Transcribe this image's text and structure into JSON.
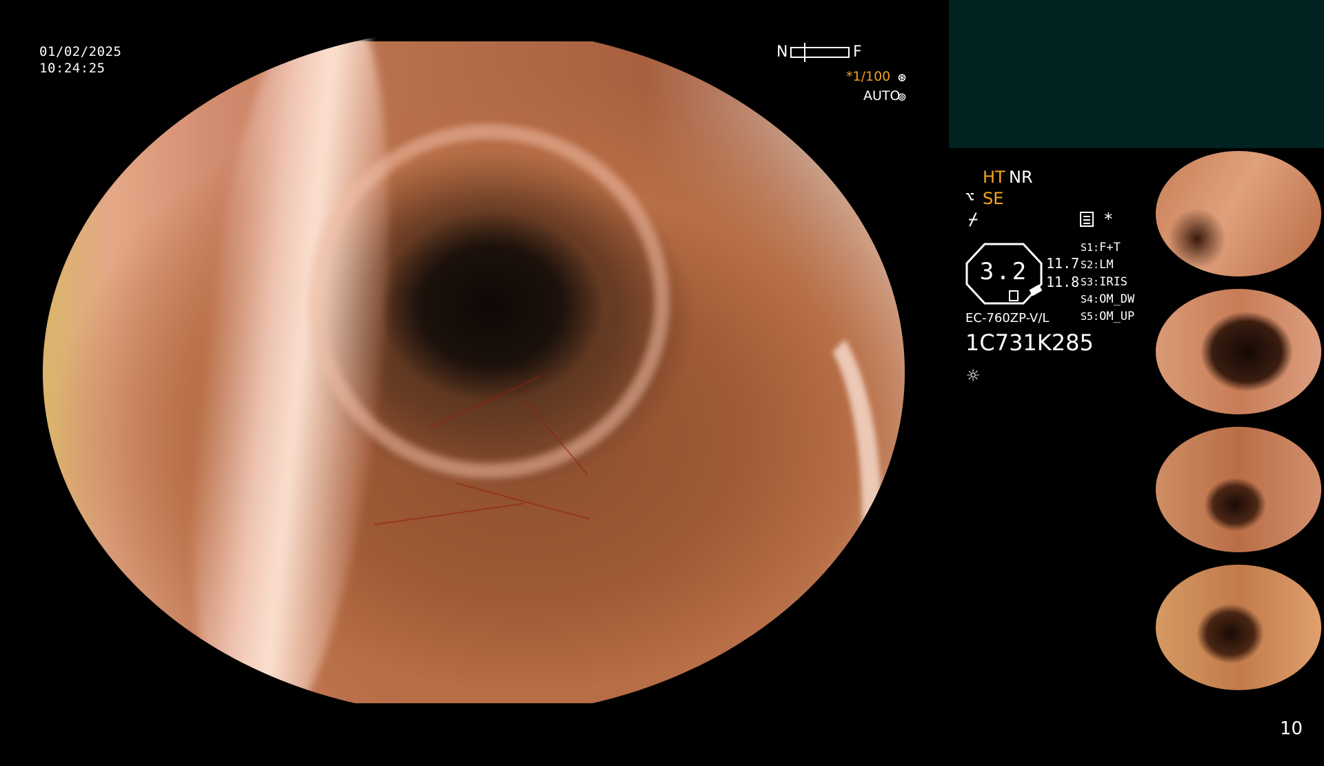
{
  "overlay": {
    "date": "01/02/2025",
    "time": "10:24:25",
    "nf_near": "N",
    "nf_far": "F",
    "shutter": "*1/100",
    "iris_mode": "AUTO"
  },
  "status": {
    "ht": "HT",
    "nr": "NR",
    "se": "SE",
    "star": "*",
    "octagon_value": "3.2",
    "value_1": "11.7",
    "value_2": "11.8",
    "switches": [
      {
        "key": "S1:",
        "value": "F+T"
      },
      {
        "key": "S2:",
        "value": "LM"
      },
      {
        "key": "S3:",
        "value": "IRIS"
      },
      {
        "key": "S4:",
        "value": "OM_DW"
      },
      {
        "key": "S5:",
        "value": "OM_UP"
      }
    ],
    "scope_model": "EC-760ZP-V/L",
    "scope_serial": "1C731K285"
  },
  "icons": {
    "shutter": "aperture-icon",
    "auto": "iris-icon",
    "se": "structure-enhance-icon",
    "slash": "color-enhance-icon",
    "doc": "document-icon",
    "light": "light-source-icon"
  },
  "footer": {
    "page_number": "10"
  },
  "colors": {
    "accent_orange": "#f5a623",
    "top_panel": "#002220"
  }
}
